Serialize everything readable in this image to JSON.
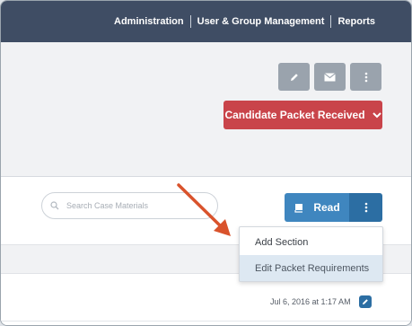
{
  "nav": {
    "links": [
      "Administration",
      "User & Group Management",
      "Reports"
    ]
  },
  "header": {
    "icon_buttons": [
      "pencil-icon",
      "envelope-icon",
      "more-vertical-icon"
    ],
    "status_button": {
      "label": "Candidate Packet Received",
      "icon": "chevron-down-icon",
      "color": "#c9444a"
    }
  },
  "toolbar": {
    "search": {
      "placeholder": "Search Case Materials",
      "icon": "search-icon"
    },
    "read_button": {
      "label": "Read",
      "icon": "book-icon",
      "color": "#3f86bf"
    },
    "more_button": {
      "icon": "more-vertical-icon",
      "color": "#2c6ea3"
    }
  },
  "menu": {
    "items": [
      "Add Section",
      "Edit Packet Requirements"
    ],
    "highlighted_index": 1
  },
  "row": {
    "timestamp": "Jul 6, 2016 at 1:17 AM",
    "edit_icon": "pencil-icon"
  },
  "colors": {
    "topbar": "#3f4d64",
    "annotation_arrow": "#d9532c"
  }
}
